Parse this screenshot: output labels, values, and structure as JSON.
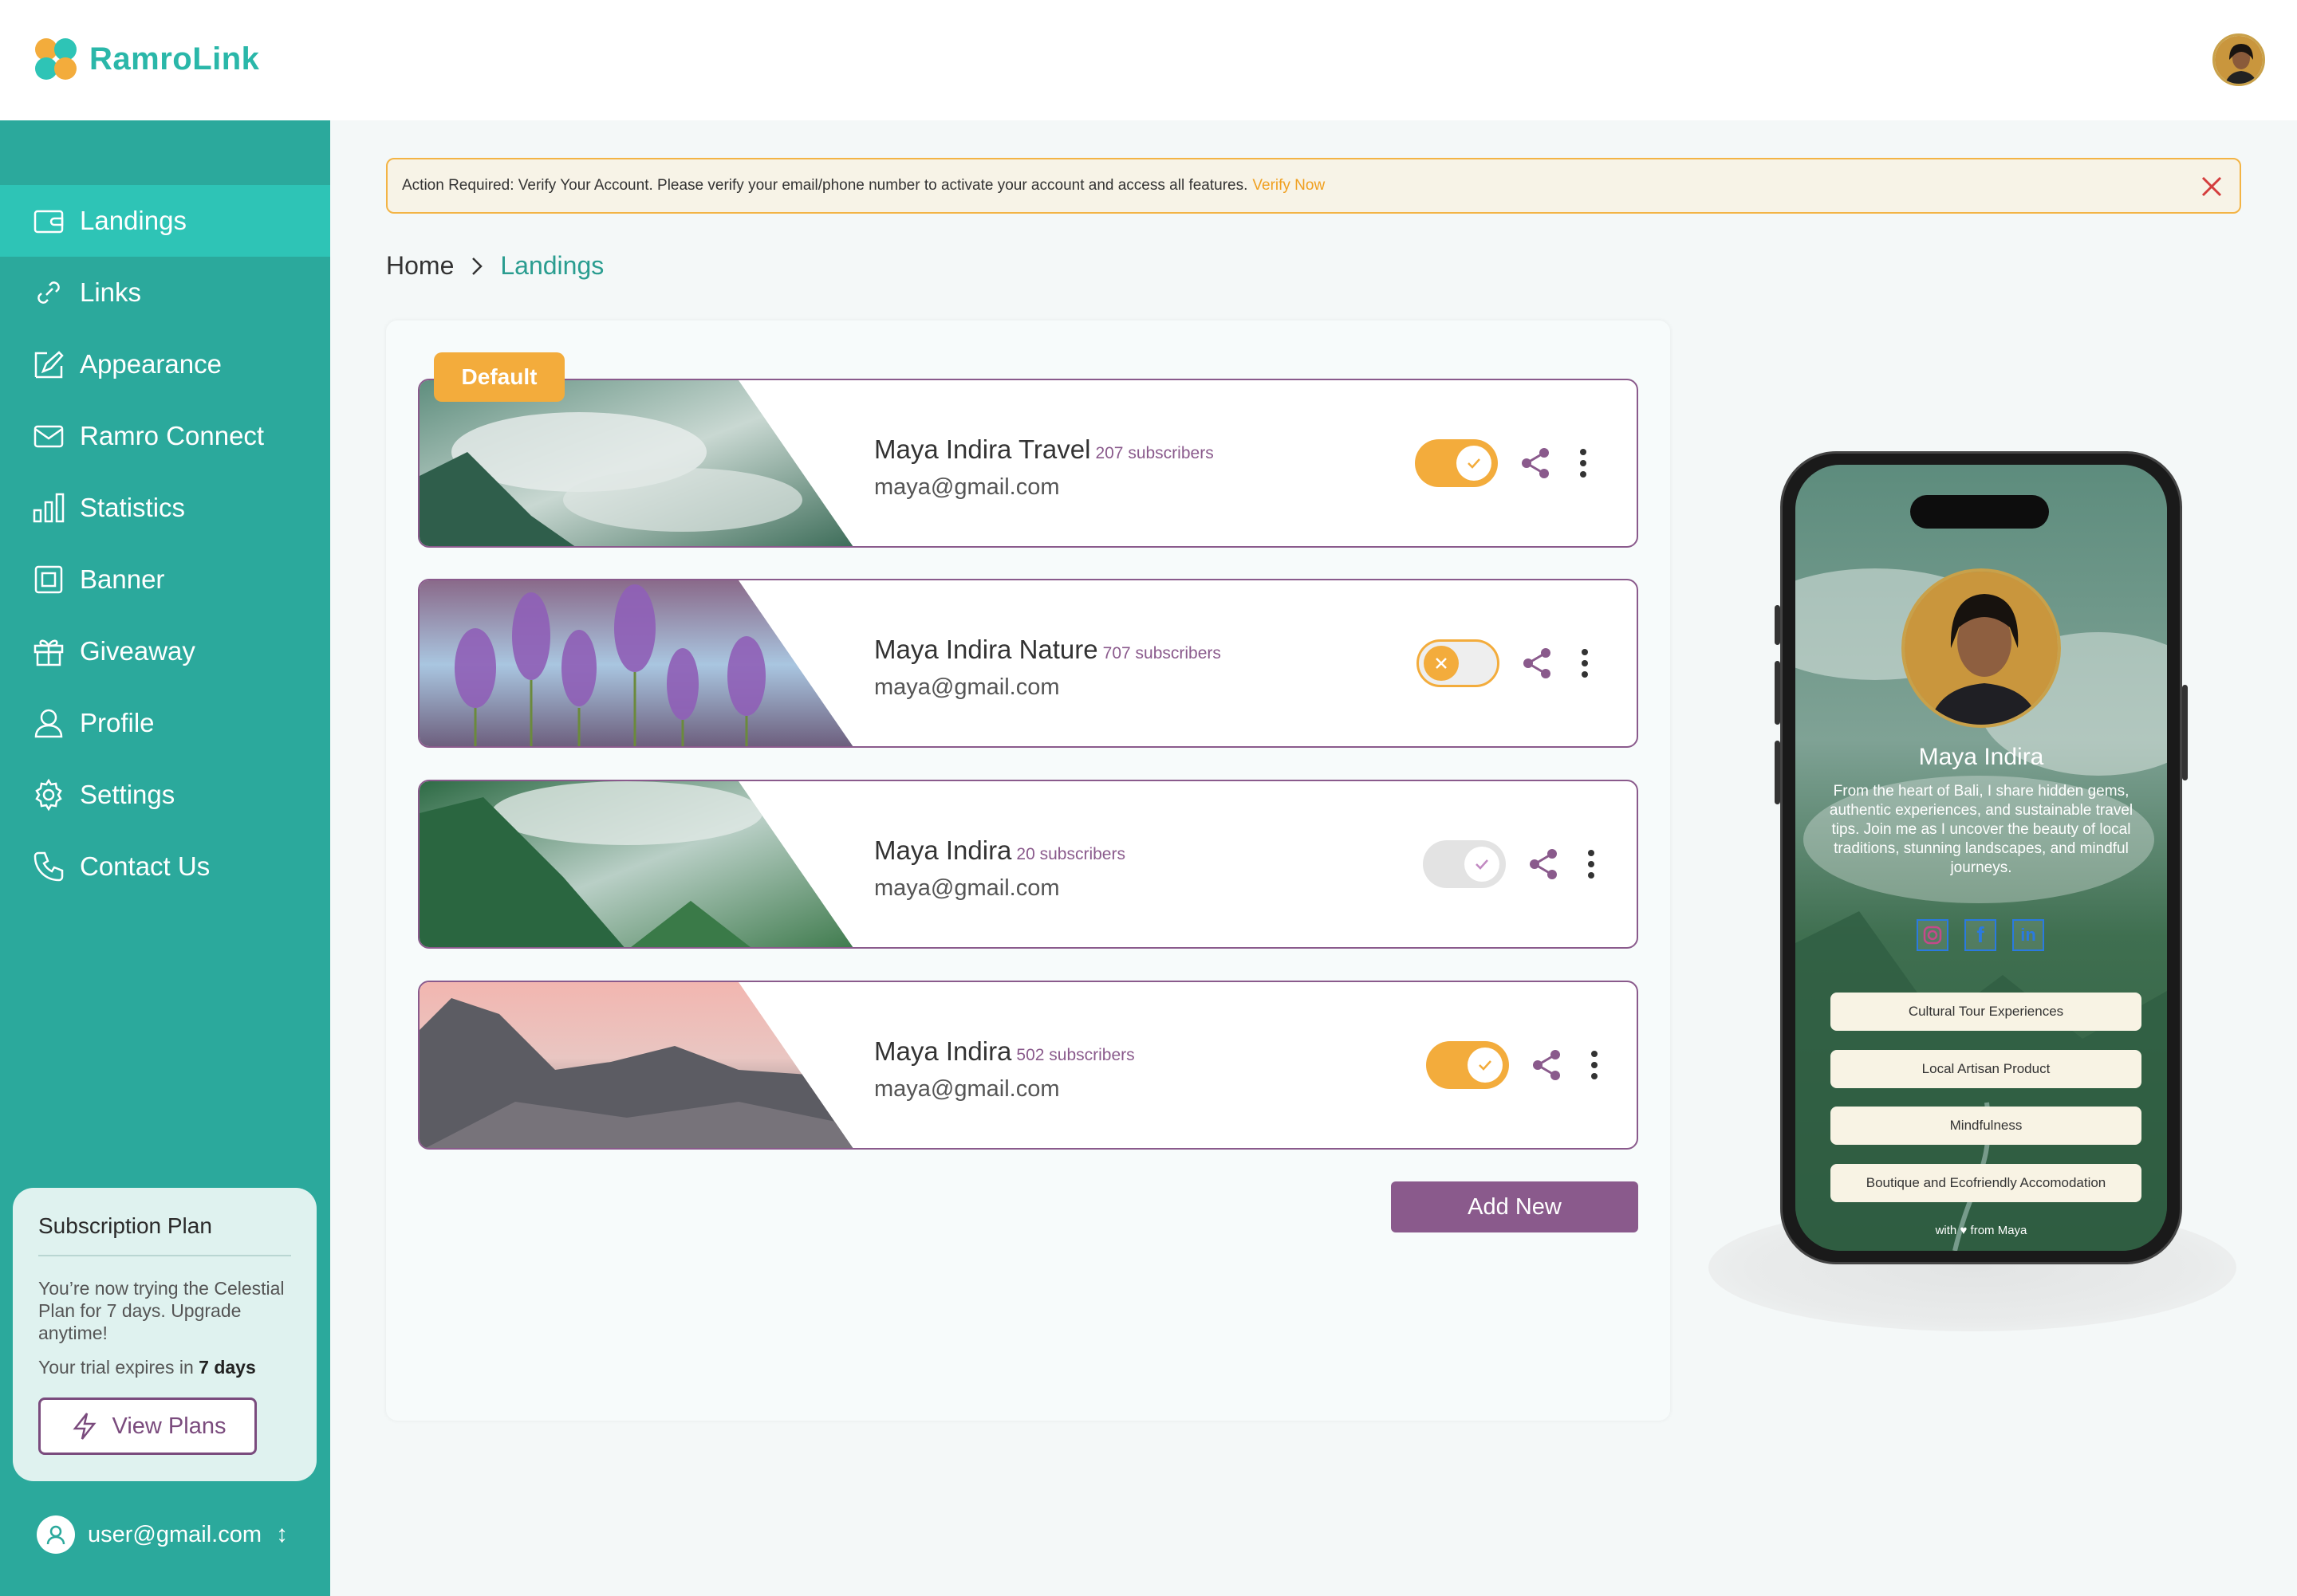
{
  "app": {
    "name": "RamroLink"
  },
  "sidebar": {
    "items": [
      {
        "label": "Landings",
        "icon": "wallet-icon",
        "active": true
      },
      {
        "label": "Links",
        "icon": "link-icon"
      },
      {
        "label": "Appearance",
        "icon": "paint-icon"
      },
      {
        "label": "Ramro Connect",
        "icon": "mail-icon"
      },
      {
        "label": "Statistics",
        "icon": "bar-chart-icon"
      },
      {
        "label": "Banner",
        "icon": "banner-icon"
      },
      {
        "label": "Giveaway",
        "icon": "gift-icon"
      },
      {
        "label": "Profile",
        "icon": "user-icon"
      },
      {
        "label": "Settings",
        "icon": "gear-icon"
      },
      {
        "label": "Contact Us",
        "icon": "phone-icon"
      }
    ],
    "plan": {
      "title": "Subscription Plan",
      "text": "You’re now trying the Celestial Plan for 7 days. Upgrade anytime!",
      "expires_prefix": "Your trial expires in ",
      "expires_value": "7 days",
      "button": "View Plans"
    },
    "user_email": "user@gmail.com"
  },
  "alert": {
    "text": "Action Required: Verify Your Account. Please verify your email/phone number to activate your account and access all features.",
    "link": "Verify Now"
  },
  "breadcrumb": {
    "home": "Home",
    "current": "Landings"
  },
  "landings": {
    "default_badge": "Default",
    "add_new": "Add New",
    "cards": [
      {
        "name": "Maya Indira Travel",
        "subscribers": "207 subscribers",
        "email": "maya@gmail.com",
        "toggle": "on"
      },
      {
        "name": "Maya Indira Nature",
        "subscribers": "707 subscribers",
        "email": "maya@gmail.com",
        "toggle": "off"
      },
      {
        "name": "Maya Indira",
        "subscribers": "20 subscribers",
        "email": "maya@gmail.com",
        "toggle": "disabled"
      },
      {
        "name": "Maya Indira",
        "subscribers": "502 subscribers",
        "email": "maya@gmail.com",
        "toggle": "on"
      }
    ]
  },
  "preview": {
    "name": "Maya Indira",
    "bio": "From the heart of Bali, I share hidden gems, authentic experiences, and sustainable travel tips. Join me as I uncover the beauty of local traditions, stunning landscapes, and mindful journeys.",
    "social": [
      "instagram-icon",
      "facebook-icon",
      "linkedin-icon"
    ],
    "links": [
      "Cultural Tour Experiences",
      "Local Artisan Product",
      "Mindfulness",
      "Boutique and Ecofriendly Accomodation"
    ],
    "footer_left": "with",
    "footer_right": "from Maya"
  },
  "colors": {
    "teal": "#2ba99c",
    "teal_active": "#2ec4b6",
    "purple": "#8a5a8c",
    "orange": "#f3ac3c"
  }
}
